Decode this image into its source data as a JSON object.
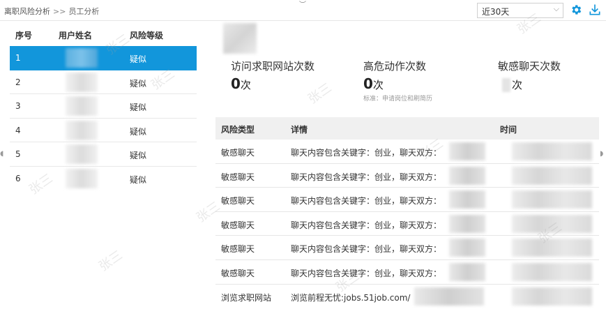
{
  "breadcrumb": {
    "parent": "离职风险分析",
    "separator": ">>",
    "current": "员工分析"
  },
  "toolbar": {
    "range_value": "近30天",
    "accent_color": "#1296db"
  },
  "employee_list": {
    "headers": {
      "index": "序号",
      "name": "用户姓名",
      "risk": "风险等级"
    },
    "rows": [
      {
        "index": "1",
        "risk": "疑似",
        "selected": true
      },
      {
        "index": "2",
        "risk": "疑似"
      },
      {
        "index": "3",
        "risk": "疑似"
      },
      {
        "index": "4",
        "risk": "疑似"
      },
      {
        "index": "5",
        "risk": "疑似"
      },
      {
        "index": "6",
        "risk": "疑似"
      }
    ]
  },
  "stats": {
    "job_site_visits": {
      "label": "访问求职网站次数",
      "value": "0",
      "unit": "次"
    },
    "high_risk_actions": {
      "label": "高危动作次数",
      "value": "0",
      "unit": "次",
      "note": "标准：申请岗位和刷简历"
    },
    "sensitive_chats": {
      "label": "敏感聊天次数",
      "unit": "次"
    }
  },
  "detail_table": {
    "headers": {
      "type": "风险类型",
      "detail": "详情",
      "time": "时间"
    },
    "rows": [
      {
        "type": "敏感聊天",
        "detail": "聊天内容包含关键字：创业，聊天双方："
      },
      {
        "type": "敏感聊天",
        "detail": "聊天内容包含关键字：创业，聊天双方："
      },
      {
        "type": "敏感聊天",
        "detail": "聊天内容包含关键字：创业，聊天双方："
      },
      {
        "type": "敏感聊天",
        "detail": "聊天内容包含关键字：创业，聊天双方："
      },
      {
        "type": "敏感聊天",
        "detail": "聊天内容包含关键字：创业，聊天双方："
      },
      {
        "type": "敏感聊天",
        "detail": "聊天内容包含关键字：创业，聊天双方："
      },
      {
        "type": "浏览求职网站",
        "detail": "浏览前程无忧:jobs.51job.com/"
      }
    ]
  },
  "watermark": {
    "text": "张三"
  }
}
